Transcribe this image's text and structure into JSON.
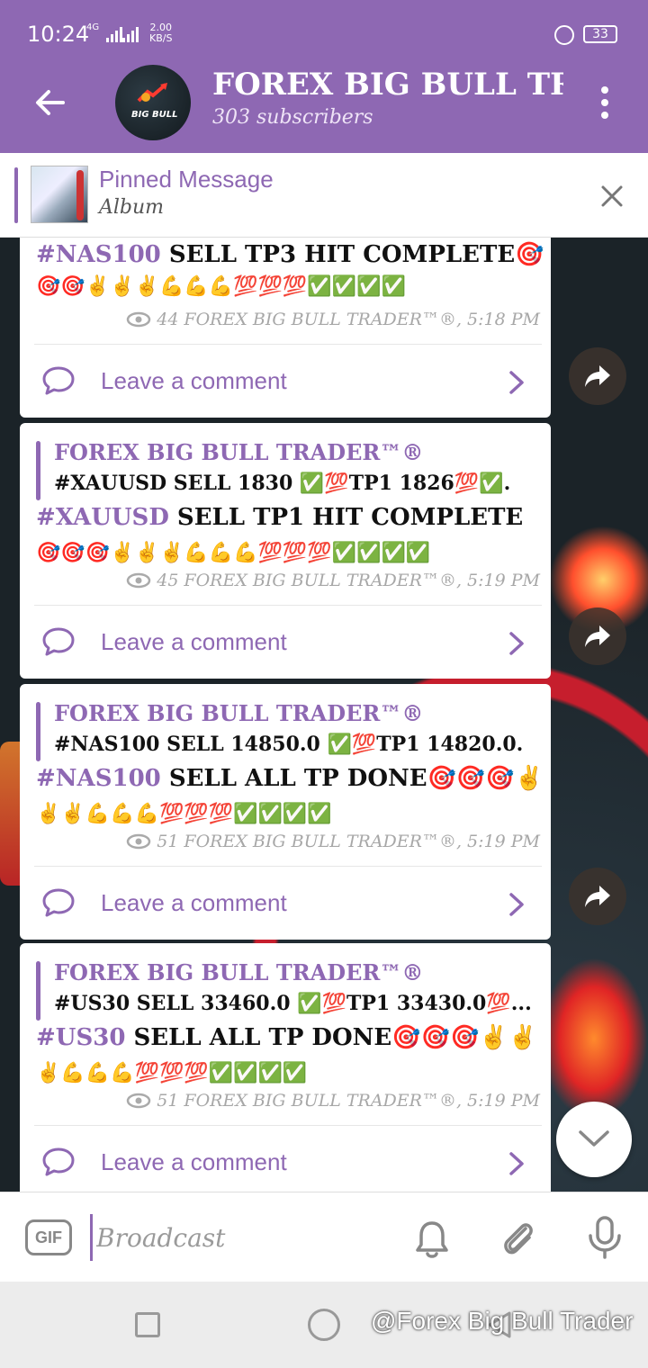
{
  "status_bar": {
    "time": "10:24",
    "network": "4G",
    "speed_value": "2.00",
    "speed_unit": "KB/S",
    "battery": "33"
  },
  "header": {
    "title": "FOREX BIG BULL TRA",
    "subscribers": "303 subscribers",
    "avatar_text": "BIG BULL"
  },
  "pinned": {
    "title": "Pinned Message",
    "subtitle": "Album"
  },
  "posts": [
    {
      "hit_tag": "#NAS100",
      "hit_text": " SELL TP3 HIT COMPLETE🎯",
      "emojis": "🎯🎯✌️✌️✌️💪💪💪💯💯💯✅✅✅✅",
      "views": "44",
      "meta": "FOREX BIG BULL TRADER™®,  5:18 PM",
      "comment": "Leave a comment"
    },
    {
      "author": "FOREX BIG BULL TRADER™®",
      "signal": "#XAUUSD SELL 1830  ✅💯TP1 1826💯✅.",
      "hit_tag": "#XAUUSD",
      "hit_text": " SELL TP1 HIT COMPLETE",
      "emojis": "🎯🎯🎯✌️✌️✌️💪💪💪💯💯💯✅✅✅✅",
      "views": "45",
      "meta": "FOREX BIG BULL TRADER™®,  5:19 PM",
      "comment": "Leave a comment"
    },
    {
      "author": "FOREX BIG BULL TRADER™®",
      "signal": "#NAS100 SELL 14850.0  ✅💯TP1 14820.0.",
      "hit_tag": "#NAS100",
      "hit_text": " SELL ALL TP DONE🎯🎯🎯✌️",
      "emojis": "✌️✌️💪💪💪💯💯💯✅✅✅✅",
      "views": "51",
      "meta": "FOREX BIG BULL TRADER™®,  5:19 PM",
      "comment": "Leave a comment"
    },
    {
      "author": "FOREX BIG BULL TRADER™®",
      "signal": "#US30 SELL 33460.0  ✅💯TP1 33430.0💯...",
      "hit_tag": "#US30",
      "hit_text": " SELL ALL TP DONE🎯🎯🎯✌️✌️",
      "emojis": "✌️💪💪💪💯💯💯✅✅✅✅",
      "views": "51",
      "meta": "FOREX BIG BULL TRADER™®,  5:19 PM",
      "comment": "Leave a comment"
    }
  ],
  "input": {
    "gif_label": "GIF",
    "placeholder": "Broadcast"
  },
  "watermark": "@Forex Big Bull Trader"
}
